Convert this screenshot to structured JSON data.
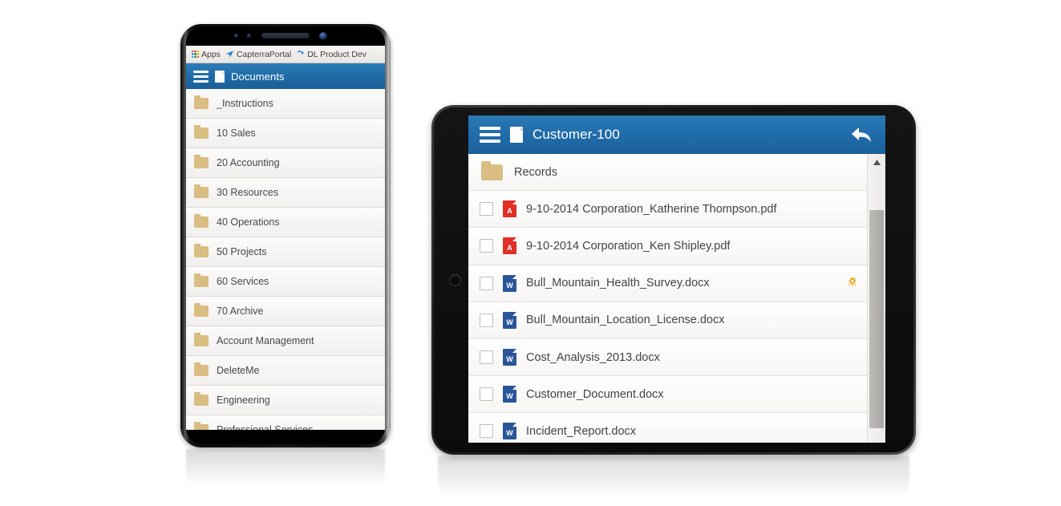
{
  "phone": {
    "browser_bookmarks": [
      {
        "label": "Apps",
        "icon": "apps-grid-icon"
      },
      {
        "label": "CapterraPortal",
        "icon": "paper-plane-icon"
      },
      {
        "label": "DL Product Dev",
        "icon": "blue-app-icon"
      }
    ],
    "header": {
      "menu_icon": "hamburger-icon",
      "doc_icon": "document-icon",
      "title": "Documents"
    },
    "folders": [
      {
        "name": "_Instructions"
      },
      {
        "name": "10 Sales"
      },
      {
        "name": "20 Accounting"
      },
      {
        "name": "30 Resources"
      },
      {
        "name": "40 Operations"
      },
      {
        "name": "50 Projects"
      },
      {
        "name": "60 Services"
      },
      {
        "name": "70 Archive"
      },
      {
        "name": "Account Management"
      },
      {
        "name": "DeleteMe"
      },
      {
        "name": "Engineering"
      },
      {
        "name": "Professional Services"
      }
    ]
  },
  "tablet": {
    "header": {
      "menu_icon": "hamburger-icon",
      "doc_icon": "document-icon",
      "title": "Customer-100",
      "back_icon": "back-arrow-icon"
    },
    "rows": [
      {
        "type": "folder",
        "name": "Records",
        "checkbox": false,
        "gear": false
      },
      {
        "type": "pdf",
        "name": "9-10-2014 Corporation_Katherine Thompson.pdf",
        "checkbox": true,
        "gear": false
      },
      {
        "type": "pdf",
        "name": "9-10-2014 Corporation_Ken Shipley.pdf",
        "checkbox": true,
        "gear": false
      },
      {
        "type": "docx",
        "name": "Bull_Mountain_Health_Survey.docx",
        "checkbox": true,
        "gear": true
      },
      {
        "type": "docx",
        "name": "Bull_Mountain_Location_License.docx",
        "checkbox": true,
        "gear": false
      },
      {
        "type": "docx",
        "name": "Cost_Analysis_2013.docx",
        "checkbox": true,
        "gear": false
      },
      {
        "type": "docx",
        "name": "Customer_Document.docx",
        "checkbox": true,
        "gear": false
      },
      {
        "type": "docx",
        "name": "Incident_Report.docx",
        "checkbox": true,
        "gear": false
      }
    ],
    "scrollbar": {
      "up_icon": "scroll-up-arrow-icon"
    }
  },
  "colors": {
    "header_blue": "#1F6BA8",
    "folder_tan": "#D9BD82",
    "pdf_red": "#DF2F26",
    "word_blue": "#2A5699",
    "gear_gold": "#E8A91D",
    "page_background": "#FFFFFF"
  },
  "file_type_glyphs": {
    "pdf": "A",
    "docx": "W"
  }
}
